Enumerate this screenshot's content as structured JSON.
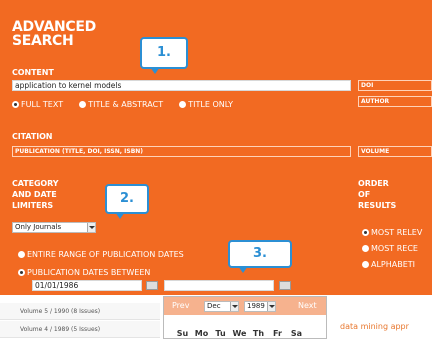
{
  "header": {
    "title_line1": "ADVANCED",
    "title_line2": "SEARCH"
  },
  "content": {
    "section_label": "CONTENT",
    "query_value": "application to kernel models",
    "field1_selected": "DOI",
    "field2_selected": "AUTHOR",
    "options": [
      "FULL TEXT",
      "TITLE & ABSTRACT",
      "TITLE ONLY"
    ],
    "selected_option": "FULL TEXT"
  },
  "citation": {
    "section_label": "CITATION",
    "publication_value": "PUBLICATION (TITLE, DOI, ISSN, ISBN)",
    "volume_value": "VOLUME"
  },
  "category": {
    "label_line1": "CATEGORY",
    "label_line2": "AND DATE",
    "label_line3": "LIMITERS",
    "journals_selected": "Only Journals",
    "date_options": [
      "ENTIRE RANGE OF PUBLICATION DATES",
      "PUBLICATION DATES BETWEEN"
    ],
    "date_selected": "PUBLICATION DATES BETWEEN",
    "start_date": "01/01/1986",
    "end_date": ""
  },
  "order": {
    "label_line1": "ORDER",
    "label_line2": "OF",
    "label_line3": "RESULTS",
    "options": [
      "MOST RELEV",
      "MOST RECE",
      "ALPHABETI"
    ],
    "selected": "MOST RELEV"
  },
  "callouts": {
    "one": "1.",
    "two": "2.",
    "three": "3."
  },
  "volumes": [
    "Volume 5 / 1990 (8 Issues)",
    "Volume 4 / 1989 (5 Issues)"
  ],
  "calendar": {
    "prev_label": "Prev",
    "next_label": "Next",
    "month": "Dec",
    "year": "1989",
    "weekdays": [
      "Su",
      "Mo",
      "Tu",
      "We",
      "Th",
      "Fr",
      "Sa"
    ]
  },
  "background_text": "data mining appr",
  "colors": {
    "panel": "#f26a22",
    "callout": "#2b8fd4",
    "calendar_header": "#f6b28e"
  }
}
